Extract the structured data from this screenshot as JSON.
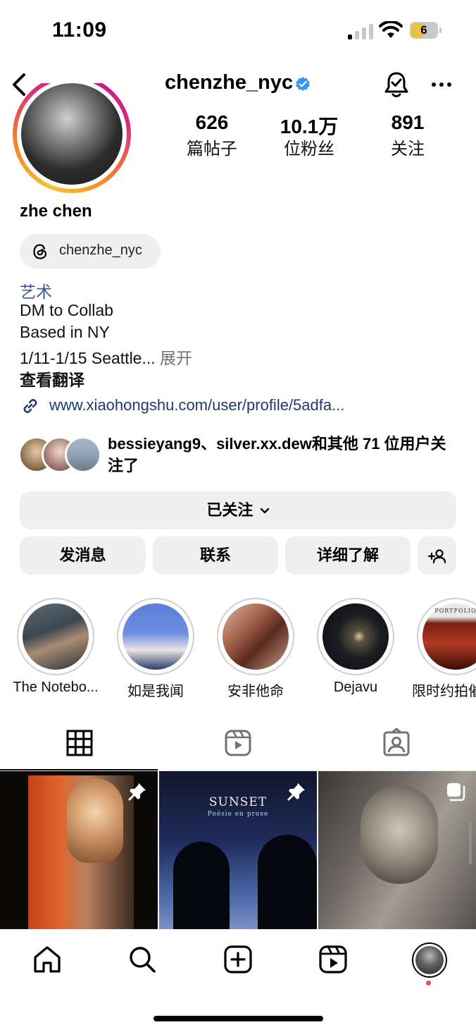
{
  "status_bar": {
    "time": "11:09",
    "battery": "6"
  },
  "header": {
    "username": "chenzhe_nyc"
  },
  "stats": [
    {
      "value": "626",
      "label": "篇帖子"
    },
    {
      "value": "10.1万",
      "label": "位粉丝"
    },
    {
      "value": "891",
      "label": "关注"
    }
  ],
  "profile": {
    "full_name": "zhe chen",
    "threads_handle": "chenzhe_nyc",
    "category": "艺术",
    "bio_lines": [
      "DM to Collab",
      "Based in NY",
      "1/11-1/15 Seattle..."
    ],
    "expand_label": "展开",
    "translate_label": "查看翻译",
    "link": "www.xiaohongshu.com/user/profile/5adfa...",
    "mutual_names": "bessieyang9、silver.xx.dew",
    "mutual_suffix": "和其他 71 位用户关注了"
  },
  "buttons": {
    "following": "已关注",
    "message": "发消息",
    "contact": "联系",
    "learn_more": "详细了解"
  },
  "highlights": [
    {
      "label": "The Notebo..."
    },
    {
      "label": "如是我闻"
    },
    {
      "label": "安非他命"
    },
    {
      "label": "Dejavu"
    },
    {
      "label": "限时约拍催"
    }
  ],
  "posts": [
    {
      "pinned": true,
      "caption": ""
    },
    {
      "pinned": true,
      "caption": "SUNSET",
      "subcaption": "Poésie en prose"
    },
    {
      "pinned": false,
      "multi": true,
      "caption": ""
    }
  ],
  "highlight_story_text": "PORTFOLIO",
  "colors": {
    "link": "#1e3a6e",
    "category": "#385898",
    "verified": "#3897f0",
    "button_bg": "#efefef",
    "notif_dot": "#ed4956"
  },
  "icons": {
    "nav": [
      "home-icon",
      "search-icon",
      "create-icon",
      "reels-icon",
      "profile-avatar"
    ],
    "tabs": [
      "grid-icon",
      "reels-tab-icon",
      "tagged-icon"
    ]
  }
}
